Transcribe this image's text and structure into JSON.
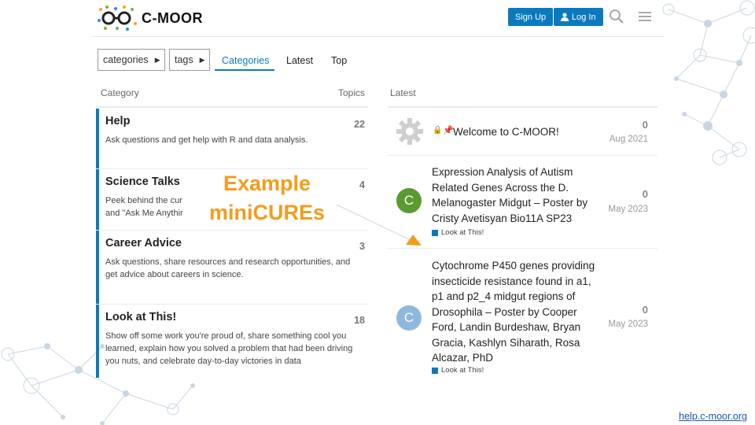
{
  "header": {
    "logo_text": "C-MOOR",
    "signup_label": "Sign Up",
    "login_label": "Log In"
  },
  "filters": {
    "categories_dropdown": "categories",
    "tags_dropdown": "tags",
    "tabs": [
      {
        "label": "Categories",
        "active": true
      },
      {
        "label": "Latest",
        "active": false
      },
      {
        "label": "Top",
        "active": false
      }
    ]
  },
  "columns": {
    "category": "Category",
    "topics": "Topics",
    "latest": "Latest"
  },
  "categories": [
    {
      "name": "Help",
      "count": "22",
      "desc": "Ask questions and get help with R and data analysis."
    },
    {
      "name": "Science Talks",
      "count": "4",
      "desc_line1": "Peek behind the cur",
      "desc_line2": "and \"Ask Me Anythir"
    },
    {
      "name": "Career Advice",
      "count": "3",
      "desc": "Ask questions, share resources and research opportunities, and get advice about careers in science."
    },
    {
      "name": "Look at This!",
      "count": "18",
      "desc": "Show off some work you're proud of, share something cool you learned, explain how you solved a problem that had been driving you nuts, and celebrate day-to-day victories in data"
    }
  ],
  "topics": [
    {
      "title": "Welcome to C-MOOR!",
      "count": "0",
      "date": "Aug 2021",
      "icon": "gear-icon"
    },
    {
      "title": "Expression Analysis of Autism Related Genes Across the D. Melanogaster Midgut – Poster by Cristy Avetisyan Bio11A SP23",
      "count": "0",
      "date": "May 2023",
      "avatar_letter": "C",
      "avatar_color": "#5b9a2f",
      "category": "Look at This!"
    },
    {
      "title": "Cytochrome P450 genes providing insecticide resistance found in a1, p1 and p2_4 midgut regions of Drosophila – Poster by Cooper Ford, Landin Burdeshaw, Bryan Gracia, Kashlyn Siharath, Rosa Alcazar, PhD",
      "count": "0",
      "date": "May 2023",
      "avatar_letter": "C",
      "avatar_color": "#8fb8dd",
      "category": "Look at This!"
    }
  ],
  "annotation": {
    "line1": "Example",
    "line2": "miniCUREs"
  },
  "footer": {
    "link": "help.c-moor.org"
  },
  "colors": {
    "accent": "#0a7abf",
    "annotation": "#f39c1b"
  }
}
